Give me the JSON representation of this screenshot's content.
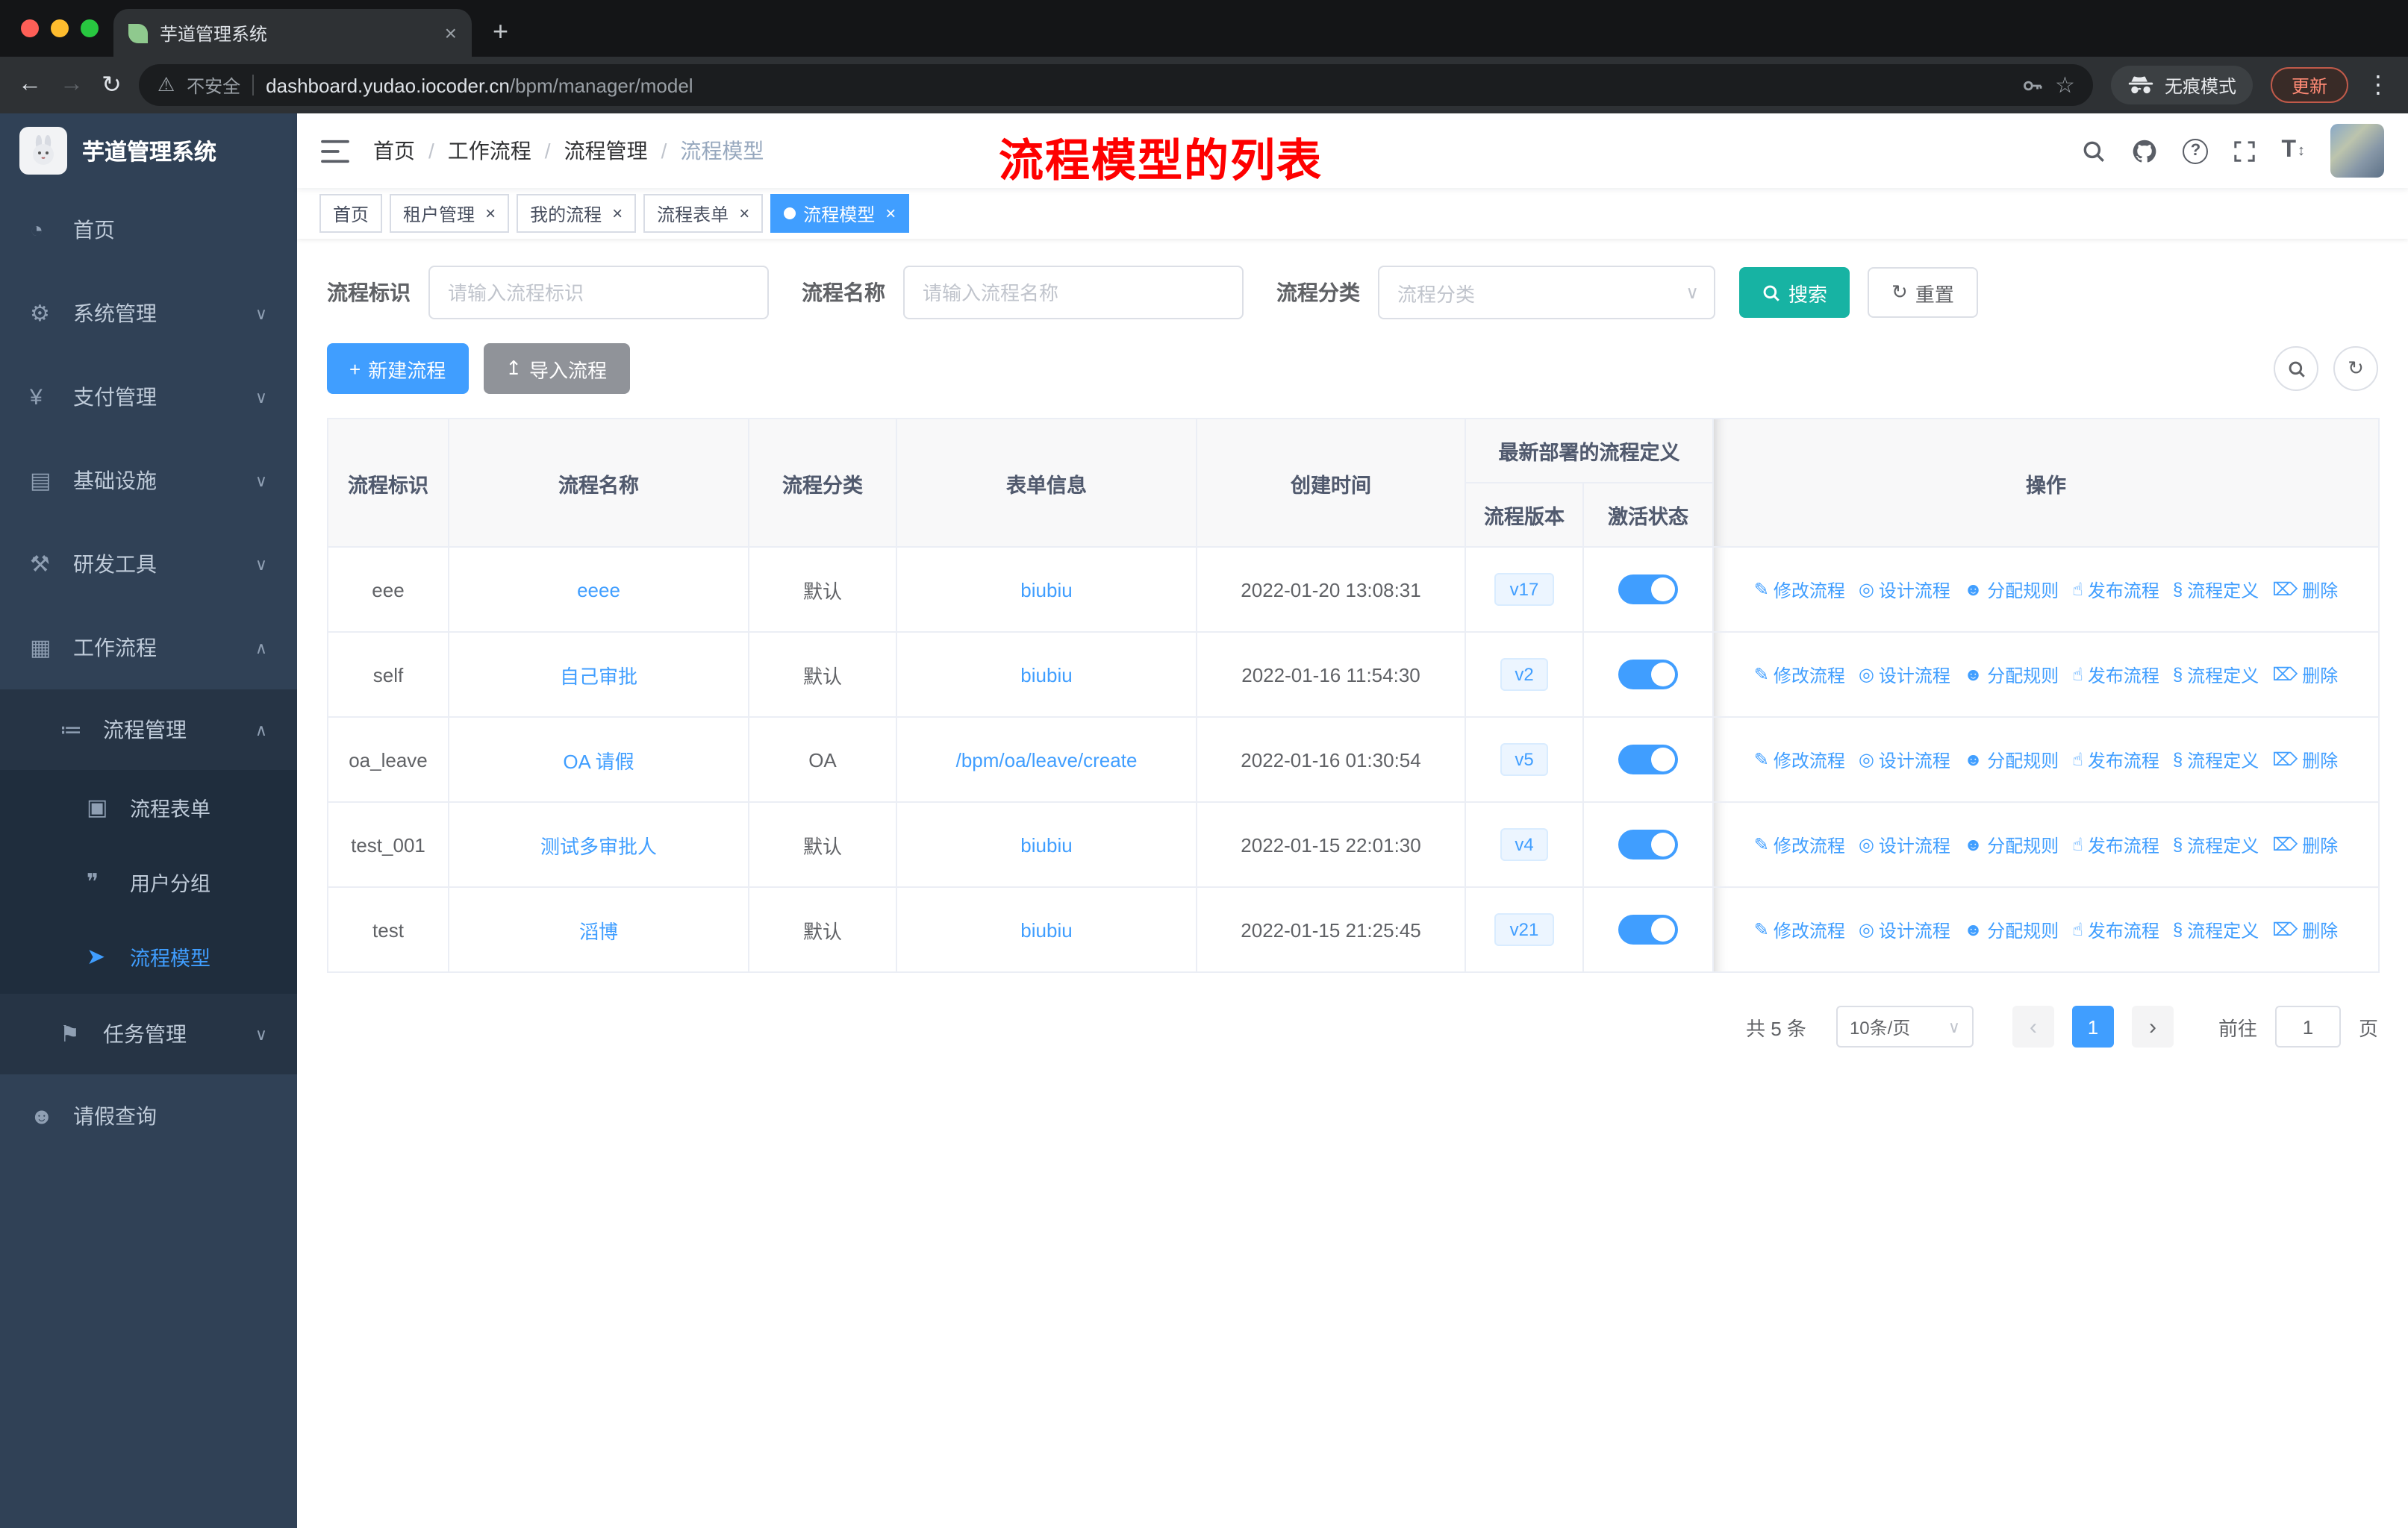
{
  "browser": {
    "tab_title": "芋道管理系统",
    "security_label": "不安全",
    "url_domain": "dashboard.yudao.iocoder.cn",
    "url_path": "/bpm/manager/model",
    "incognito_label": "无痕模式",
    "update_label": "更新"
  },
  "sidebar": {
    "logo_title": "芋道管理系统",
    "items": [
      {
        "name": "home",
        "label": "首页",
        "icon": "◔",
        "level": 0
      },
      {
        "name": "system-management",
        "label": "系统管理",
        "icon": "⚙",
        "level": 0,
        "chevron": "down"
      },
      {
        "name": "payment-management",
        "label": "支付管理",
        "icon": "¥",
        "level": 0,
        "chevron": "down"
      },
      {
        "name": "infrastructure",
        "label": "基础设施",
        "icon": "▤",
        "level": 0,
        "chevron": "down"
      },
      {
        "name": "dev-tools",
        "label": "研发工具",
        "icon": "⚒",
        "level": 0,
        "chevron": "down"
      },
      {
        "name": "workflow",
        "label": "工作流程",
        "icon": "▦",
        "level": 0,
        "chevron": "up"
      },
      {
        "name": "process-management",
        "label": "流程管理",
        "icon": "≔",
        "level": 1,
        "chevron": "up"
      },
      {
        "name": "process-form",
        "label": "流程表单",
        "icon": "▣",
        "level": 2
      },
      {
        "name": "user-group",
        "label": "用户分组",
        "icon": "❞",
        "level": 2
      },
      {
        "name": "process-model",
        "label": "流程模型",
        "icon": "➤",
        "level": 2,
        "active": true
      },
      {
        "name": "task-management",
        "label": "任务管理",
        "icon": "⚑",
        "level": 1,
        "chevron": "down"
      },
      {
        "name": "leave-query",
        "label": "请假查询",
        "icon": "☻",
        "level": 0
      }
    ]
  },
  "navbar": {
    "breadcrumbs": [
      "首页",
      "工作流程",
      "流程管理",
      "流程模型"
    ],
    "annotation": "流程模型的列表"
  },
  "tags": [
    {
      "name": "home",
      "label": "首页",
      "closable": false,
      "active": false
    },
    {
      "name": "tenant-management",
      "label": "租户管理",
      "closable": true,
      "active": false
    },
    {
      "name": "my-process",
      "label": "我的流程",
      "closable": true,
      "active": false
    },
    {
      "name": "process-form",
      "label": "流程表单",
      "closable": true,
      "active": false
    },
    {
      "name": "process-model",
      "label": "流程模型",
      "closable": true,
      "active": true
    }
  ],
  "filters": {
    "id_label": "流程标识",
    "id_placeholder": "请输入流程标识",
    "name_label": "流程名称",
    "name_placeholder": "请输入流程名称",
    "category_label": "流程分类",
    "category_placeholder": "流程分类",
    "search_button": "搜索",
    "reset_button": "重置"
  },
  "toolbar": {
    "create_label": "新建流程",
    "import_label": "导入流程"
  },
  "table": {
    "headers": {
      "id": "流程标识",
      "name": "流程名称",
      "category": "流程分类",
      "form": "表单信息",
      "created": "创建时间",
      "deploy_group": "最新部署的流程定义",
      "version": "流程版本",
      "status": "激活状态",
      "actions": "操作"
    },
    "rows": [
      {
        "id": "eee",
        "name": "eeee",
        "category": "默认",
        "form": "biubiu",
        "created": "2022-01-20 13:08:31",
        "version": "v17",
        "active": true
      },
      {
        "id": "self",
        "name": "自己审批",
        "category": "默认",
        "form": "biubiu",
        "created": "2022-01-16 11:54:30",
        "version": "v2",
        "active": true
      },
      {
        "id": "oa_leave",
        "name": "OA 请假",
        "category": "OA",
        "form": "/bpm/oa/leave/create",
        "created": "2022-01-16 01:30:54",
        "version": "v5",
        "active": true
      },
      {
        "id": "test_001",
        "name": "测试多审批人",
        "category": "默认",
        "form": "biubiu",
        "created": "2022-01-15 22:01:30",
        "version": "v4",
        "active": true
      },
      {
        "id": "test",
        "name": "滔博",
        "category": "默认",
        "form": "biubiu",
        "created": "2022-01-15 21:25:45",
        "version": "v21",
        "active": true
      }
    ],
    "actions": [
      {
        "name": "modify",
        "label": "修改流程",
        "icon": "✎"
      },
      {
        "name": "design",
        "label": "设计流程",
        "icon": "◎"
      },
      {
        "name": "assign",
        "label": "分配规则",
        "icon": "☻"
      },
      {
        "name": "publish",
        "label": "发布流程",
        "icon": "☝"
      },
      {
        "name": "definition",
        "label": "流程定义",
        "icon": "§"
      },
      {
        "name": "delete",
        "label": "删除",
        "icon": "⌦"
      }
    ]
  },
  "pagination": {
    "total": "共 5 条",
    "page_size": "10条/页",
    "prev": "‹",
    "page": "1",
    "next": "›",
    "goto": "前往",
    "page_unit": "页"
  },
  "icons": {
    "back": "←",
    "forward": "→",
    "reload": "↻",
    "kebab": "⋮",
    "close": "×",
    "plus": "+",
    "upload": "↥",
    "refresh": "↻",
    "chevron_down": "∨",
    "chevron_up": "∧",
    "help": "?",
    "fontsize": "T",
    "updown": "↕",
    "warning": "⚠",
    "star": "☆"
  }
}
